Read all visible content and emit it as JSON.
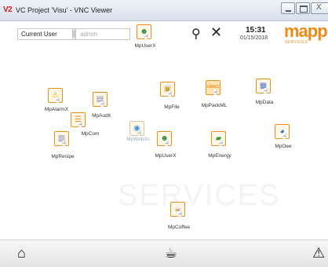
{
  "window": {
    "logo": "V2",
    "title": "VC Project 'Visu' - VNC Viewer",
    "close_glyph": "X"
  },
  "header": {
    "current_user_label": "Current User",
    "user_value": "admin",
    "time": "15:31",
    "date": "01/15/2018",
    "logo_text": "mapp",
    "logo_subtext": "SERVICES",
    "header_tile_label": "MpUserX",
    "search_icon": "⚲",
    "tools_icon": "✕"
  },
  "watermark": "SERVICES",
  "tiles": [
    {
      "label": "MpAlarmX",
      "icon": "⚠",
      "color": "#e9b400"
    },
    {
      "label": "MpCom",
      "icon": "☰",
      "color": "#e98f1c"
    },
    {
      "label": "MpAudit",
      "icon": "▤",
      "color": "#7a8aa8"
    },
    {
      "label": "MpWebXs",
      "icon": "◉",
      "color": "#4a90d9"
    },
    {
      "label": "MpFile",
      "icon": "▣",
      "color": "#c9a040"
    },
    {
      "label": "MpPackML",
      "icon": "OMAC",
      "color": "#e98f1c"
    },
    {
      "label": "MpData",
      "icon": "▦",
      "color": "#5577bb"
    },
    {
      "label": "MpRecipe",
      "icon": "▥",
      "color": "#7a8aa8"
    },
    {
      "label": "MpUserX",
      "icon": "☻",
      "color": "#2f8f3f"
    },
    {
      "label": "MpEnergy",
      "icon": "▰",
      "color": "#3a9a3a"
    },
    {
      "label": "MpOee",
      "icon": "◕",
      "color": "#1c6fb5"
    },
    {
      "label": "MpCoffee",
      "icon": "☕",
      "color": "#a0522d"
    }
  ],
  "footer": {
    "home_icon": "⌂",
    "coffee_icon": "☕",
    "warning_icon": "⚠"
  }
}
